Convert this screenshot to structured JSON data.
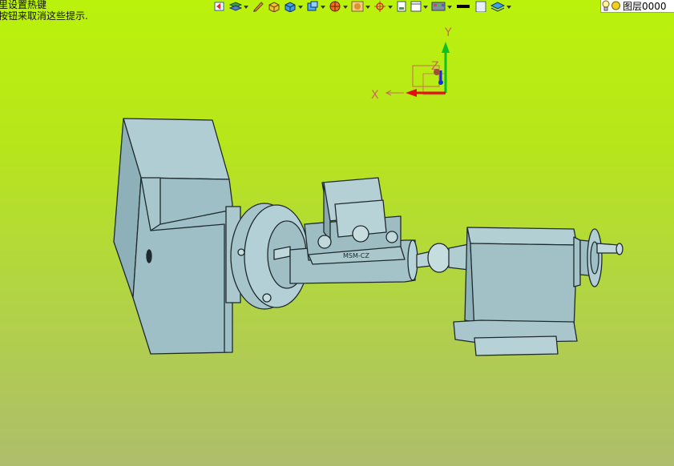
{
  "hints": {
    "line1": "里设置热键",
    "line2": "按钮来取消这些提示."
  },
  "layer": {
    "label": "图层0000"
  },
  "axes": {
    "x_label": "X",
    "y_label": "Y",
    "z_label": "Z"
  },
  "model": {
    "vise_marking": "MSM-CZ"
  },
  "toolbar": {
    "icons": [
      "undo-icon",
      "layers-stack-icon",
      "sketch-pen-icon",
      "solid-box-icon",
      "cube-view-icon",
      "iso-view-icon",
      "shading-sphere-icon",
      "render-icon",
      "snap-target-icon",
      "new-file-icon",
      "frame-window-icon",
      "color-palette-icon",
      "line-color-swatch",
      "fill-color-swatch",
      "layer-tool-icon",
      "light-bulb-icon",
      "sun-icon"
    ]
  },
  "colors": {
    "background_top": "#bbf20b",
    "background_bottom": "#aebd6c",
    "model_fill": "#9fbfc6",
    "model_stroke": "#1e2a2e",
    "axis_x": "#e01010",
    "axis_y": "#10c020",
    "axis_z": "#1030e0"
  }
}
